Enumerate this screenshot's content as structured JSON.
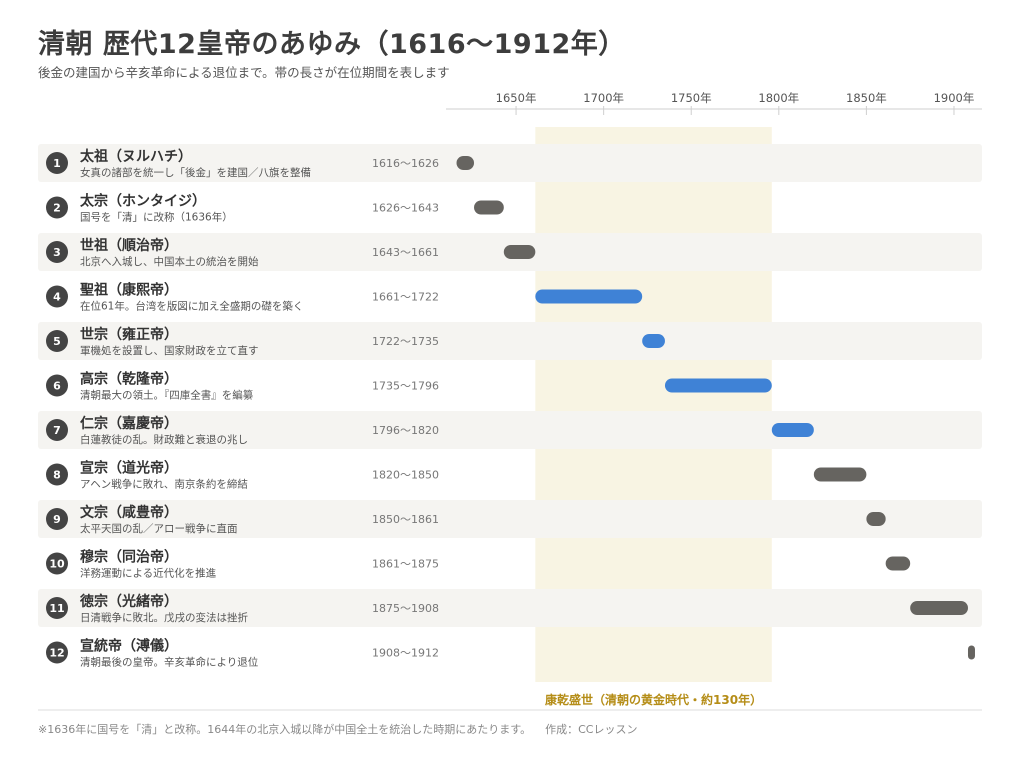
{
  "title": "清朝 歴代12皇帝のあゆみ（1616〜1912年）",
  "subtitle": "後金の建国から辛亥革命による退位まで。帯の長さが在位期間を表します",
  "footnote": "※1636年に国号を「清」と改称。1644年の北京入城以降が中国全土を統治した時期にあたります。",
  "credit": "作成：CCレッスン",
  "colors": {
    "highlight_bar": "#3f82d6",
    "normal_bar": "#666460",
    "golden_age_band": "#f8f4e3",
    "golden_age_label": "#b58d17",
    "row_stripe": "#f5f4f1",
    "badge": "#444444"
  },
  "chart_data": {
    "type": "gantt",
    "x_ticks": [
      "1650年",
      "1700年",
      "1750年",
      "1800年",
      "1850年",
      "1900年"
    ],
    "x_tick_values": [
      1650,
      1700,
      1750,
      1800,
      1850,
      1900
    ],
    "xlim": [
      1610,
      1916
    ],
    "band": {
      "start": 1661,
      "end": 1796,
      "label": "康乾盛世（清朝の黄金時代・約130年）"
    },
    "emperors": [
      {
        "no": "1",
        "name": "太祖（ヌルハチ）",
        "desc": "女真の諸部を統一し「後金」を建国／八旗を整備",
        "range": "1616〜1626",
        "start": 1616,
        "end": 1626,
        "highlight": false
      },
      {
        "no": "2",
        "name": "太宗（ホンタイジ）",
        "desc": "国号を「清」に改称（1636年）",
        "range": "1626〜1643",
        "start": 1626,
        "end": 1643,
        "highlight": false
      },
      {
        "no": "3",
        "name": "世祖（順治帝）",
        "desc": "北京へ入城し、中国本土の統治を開始",
        "range": "1643〜1661",
        "start": 1643,
        "end": 1661,
        "highlight": false
      },
      {
        "no": "4",
        "name": "聖祖（康熙帝）",
        "desc": "在位61年。台湾を版図に加え全盛期の礎を築く",
        "range": "1661〜1722",
        "start": 1661,
        "end": 1722,
        "highlight": true
      },
      {
        "no": "5",
        "name": "世宗（雍正帝）",
        "desc": "軍機処を設置し、国家財政を立て直す",
        "range": "1722〜1735",
        "start": 1722,
        "end": 1735,
        "highlight": true
      },
      {
        "no": "6",
        "name": "高宗（乾隆帝）",
        "desc": "清朝最大の領土。『四庫全書』を編纂",
        "range": "1735〜1796",
        "start": 1735,
        "end": 1796,
        "highlight": true
      },
      {
        "no": "7",
        "name": "仁宗（嘉慶帝）",
        "desc": "白蓮教徒の乱。財政難と衰退の兆し",
        "range": "1796〜1820",
        "start": 1796,
        "end": 1820,
        "highlight": true
      },
      {
        "no": "8",
        "name": "宣宗（道光帝）",
        "desc": "アヘン戦争に敗れ、南京条約を締結",
        "range": "1820〜1850",
        "start": 1820,
        "end": 1850,
        "highlight": false
      },
      {
        "no": "9",
        "name": "文宗（咸豊帝）",
        "desc": "太平天国の乱／アロー戦争に直面",
        "range": "1850〜1861",
        "start": 1850,
        "end": 1861,
        "highlight": false
      },
      {
        "no": "10",
        "name": "穆宗（同治帝）",
        "desc": "洋務運動による近代化を推進",
        "range": "1861〜1875",
        "start": 1861,
        "end": 1875,
        "highlight": false
      },
      {
        "no": "11",
        "name": "徳宗（光緒帝）",
        "desc": "日清戦争に敗北。戊戌の変法は挫折",
        "range": "1875〜1908",
        "start": 1875,
        "end": 1908,
        "highlight": false
      },
      {
        "no": "12",
        "name": "宣統帝（溥儀）",
        "desc": "清朝最後の皇帝。辛亥革命により退位",
        "range": "1908〜1912",
        "start": 1908,
        "end": 1912,
        "highlight": false
      }
    ]
  }
}
